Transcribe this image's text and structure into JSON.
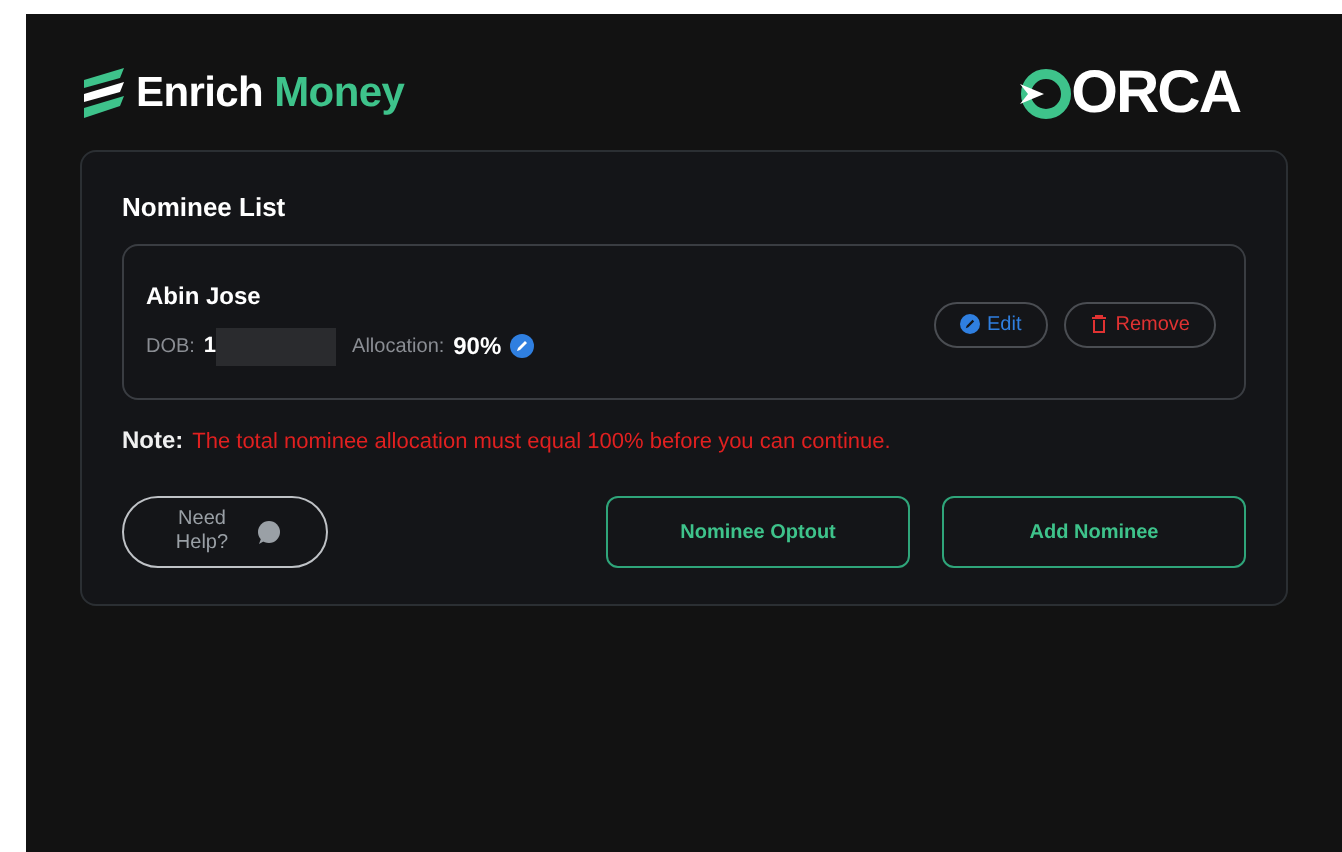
{
  "brand": {
    "name_part_1": "Enrich",
    "name_part_2": "Money",
    "partner_logo": "ORCA"
  },
  "section": {
    "title": "Nominee List"
  },
  "nominees": [
    {
      "name": "Abin Jose",
      "dob_label": "DOB:",
      "dob_value": "1",
      "dob_redacted": true,
      "allocation_label": "Allocation:",
      "allocation_value": "90%",
      "edit_label": "Edit",
      "remove_label": "Remove"
    }
  ],
  "note": {
    "label": "Note:",
    "text": "The total nominee allocation must equal 100% before you can continue."
  },
  "help_button": {
    "label": "Need Help?"
  },
  "actions": [
    "Nominee Optout",
    "Add Nominee"
  ]
}
